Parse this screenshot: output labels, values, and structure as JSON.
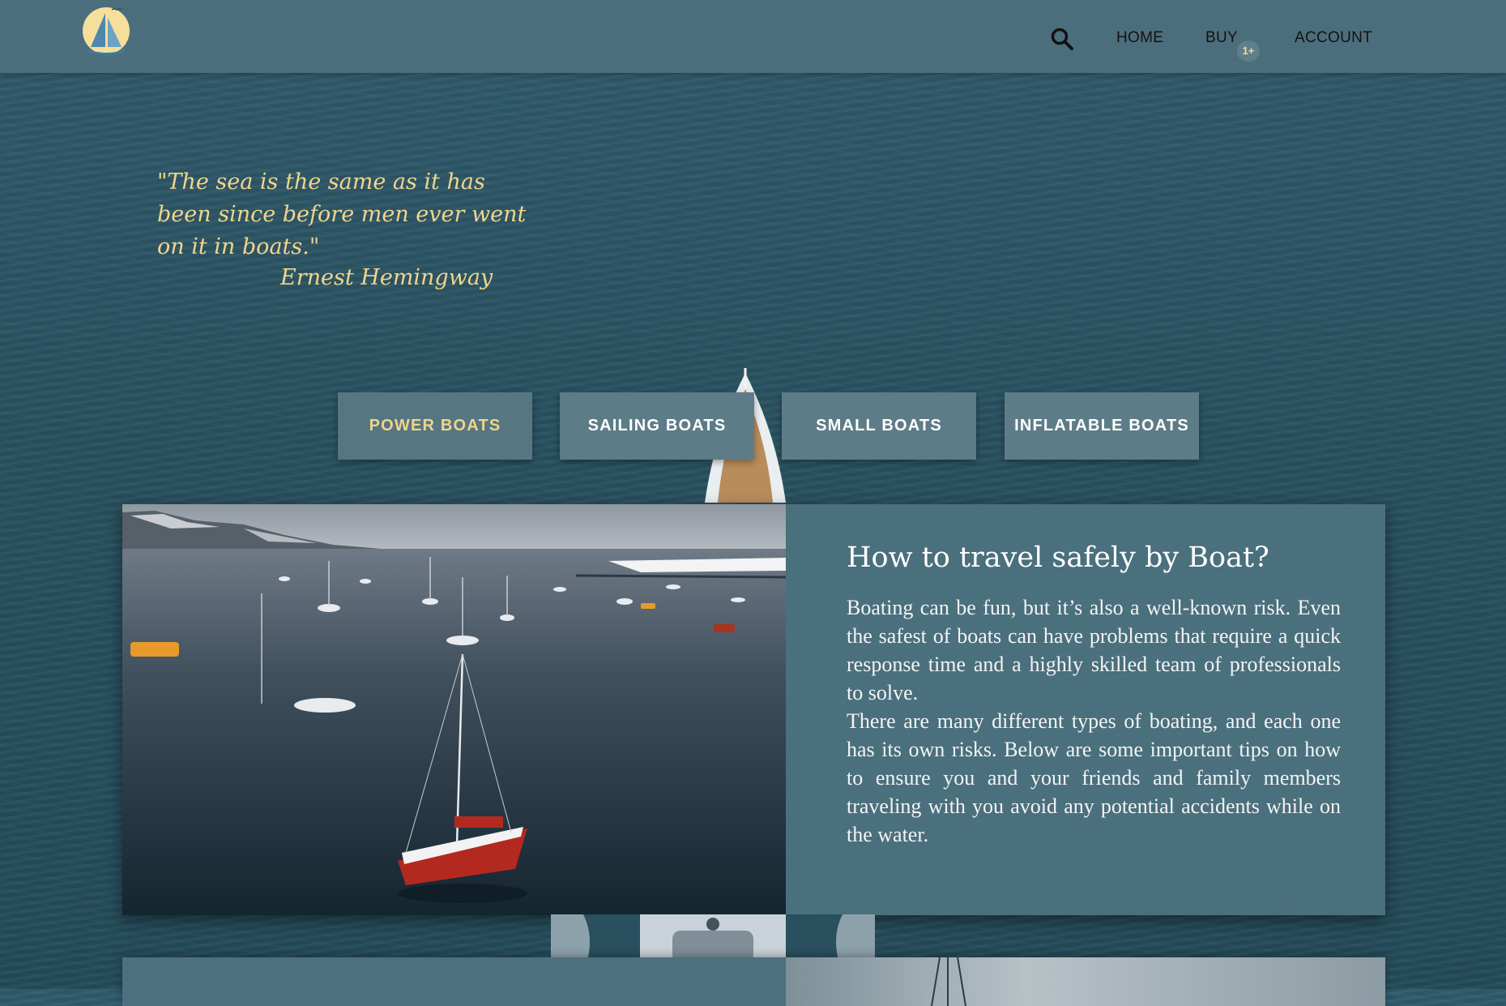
{
  "nav": {
    "logo_icon": "sailboat-logo",
    "search_icon": "search-icon",
    "home": "HOME",
    "buy": "BUY",
    "cart_badge": "1+",
    "account": "ACCOUNT"
  },
  "quote": {
    "text": "\"The sea is the same as it has been since before men ever went on it in boats.\"",
    "author": "Ernest Hemingway"
  },
  "categories": [
    {
      "label": "POWER BOATS",
      "active": true
    },
    {
      "label": "SAILING BOATS",
      "active": false
    },
    {
      "label": "SMALL BOATS",
      "active": false
    },
    {
      "label": "INFLATABLE BOATS",
      "active": false
    }
  ],
  "article": {
    "title": "How to travel safely by Boat?",
    "paragraphs": [
      "Boating can be fun, but it’s also a well-known risk. Even the safest of boats can have problems that require a quick response time and a highly skilled team of professionals to solve.",
      "There are many different types of boating, and each one has its own risks. Below are some important tips on how to ensure you and your friends and family members traveling with you avoid any potential accidents while on the water."
    ],
    "image": "harbor-with-sailboats-photo"
  },
  "colors": {
    "accent_gold": "#f2d58c",
    "nav_bg": "#4e707e",
    "button_bg": "#5d7c87",
    "sea": "#28505f"
  }
}
